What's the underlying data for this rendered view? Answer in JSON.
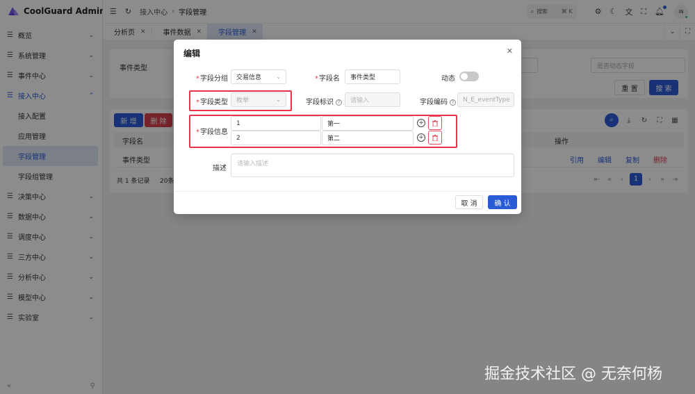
{
  "app": {
    "title": "CoolGuard Admin"
  },
  "sidebar": {
    "items": [
      {
        "label": "概览",
        "open": false
      },
      {
        "label": "系统管理",
        "open": false
      },
      {
        "label": "事件中心",
        "open": false
      },
      {
        "label": "接入中心",
        "open": true
      },
      {
        "label": "决策中心",
        "open": false
      },
      {
        "label": "数据中心",
        "open": false
      },
      {
        "label": "调度中心",
        "open": false
      },
      {
        "label": "三方中心",
        "open": false
      },
      {
        "label": "分析中心",
        "open": false
      },
      {
        "label": "模型中心",
        "open": false
      },
      {
        "label": "实验室",
        "open": false
      }
    ],
    "sub_items": [
      "接入配置",
      "应用管理",
      "字段管理",
      "字段组管理"
    ],
    "active_sub": "字段管理",
    "collapse_icon": "«",
    "pin_icon": "⚲"
  },
  "header": {
    "breadcrumb": [
      "接入中心",
      "字段管理"
    ],
    "search_label": "搜索",
    "search_kbd": "⌘ K",
    "avatar_text": "IN"
  },
  "tabs": [
    {
      "label": "分析页",
      "active": false
    },
    {
      "label": "事件数据",
      "active": false
    },
    {
      "label": "字段管理",
      "active": true
    }
  ],
  "page": {
    "filter_label": "事件类型",
    "filter_select2": "",
    "filter_select3": "是否动态字段",
    "reset_label": "重 置",
    "search_label": "搜 索",
    "add_label": "新 增",
    "delete_label": "删 除",
    "columns": [
      "字段名",
      "操作"
    ],
    "rows": [
      {
        "name": "事件类型",
        "ops": [
          "引用",
          "编辑",
          "复制",
          "删除"
        ]
      }
    ],
    "total_text": "共 1 条记录",
    "page_size": "20条/",
    "current_page": "1"
  },
  "modal": {
    "title": "编辑",
    "fields": {
      "group_label": "字段分组",
      "group_value": "交易信息",
      "name_label": "字段名",
      "name_value": "事件类型",
      "dynamic_label": "动态",
      "dynamic_on": false,
      "type_label": "字段类型",
      "type_value": "枚举",
      "ident_label": "字段标识",
      "ident_placeholder": "请输入",
      "code_label": "字段编码",
      "code_value": "N_E_eventType",
      "info_label": "字段信息",
      "info_rows": [
        {
          "key": "1",
          "value": "第一"
        },
        {
          "key": "2",
          "value": "第二"
        }
      ],
      "desc_label": "描述",
      "desc_placeholder": "请输入描述"
    },
    "cancel_label": "取 消",
    "ok_label": "确 认"
  },
  "watermark": "掘金技术社区 @ 无奈何杨",
  "colors": {
    "primary": "#2a5bd7",
    "danger": "#d9404f",
    "highlight": "#e8334a"
  }
}
